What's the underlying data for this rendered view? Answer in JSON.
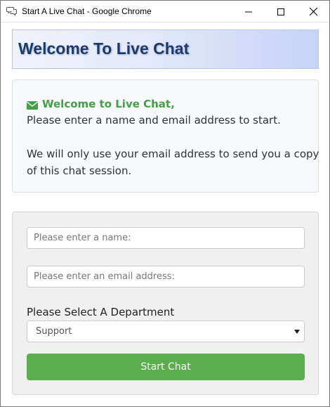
{
  "window": {
    "title": "Start A Live Chat - Google Chrome",
    "icon": "chat-bubbles-icon"
  },
  "banner": {
    "text": "Welcome To Live Chat"
  },
  "welcome": {
    "icon": "envelope-icon",
    "heading": "Welcome to Live Chat,",
    "line1": "Please enter a name and email address to start.",
    "line2": "We will only use your email address to send you a copy",
    "line3": "of this chat session."
  },
  "form": {
    "name_placeholder": "Please enter a name:",
    "email_placeholder": "Please enter an email address:",
    "department_label": "Please Select A Department",
    "department_selected": "Support",
    "submit_label": "Start Chat"
  },
  "colors": {
    "accent_green": "#43a047",
    "button_green": "#5cad4e",
    "banner_text": "#1b3b6a"
  }
}
